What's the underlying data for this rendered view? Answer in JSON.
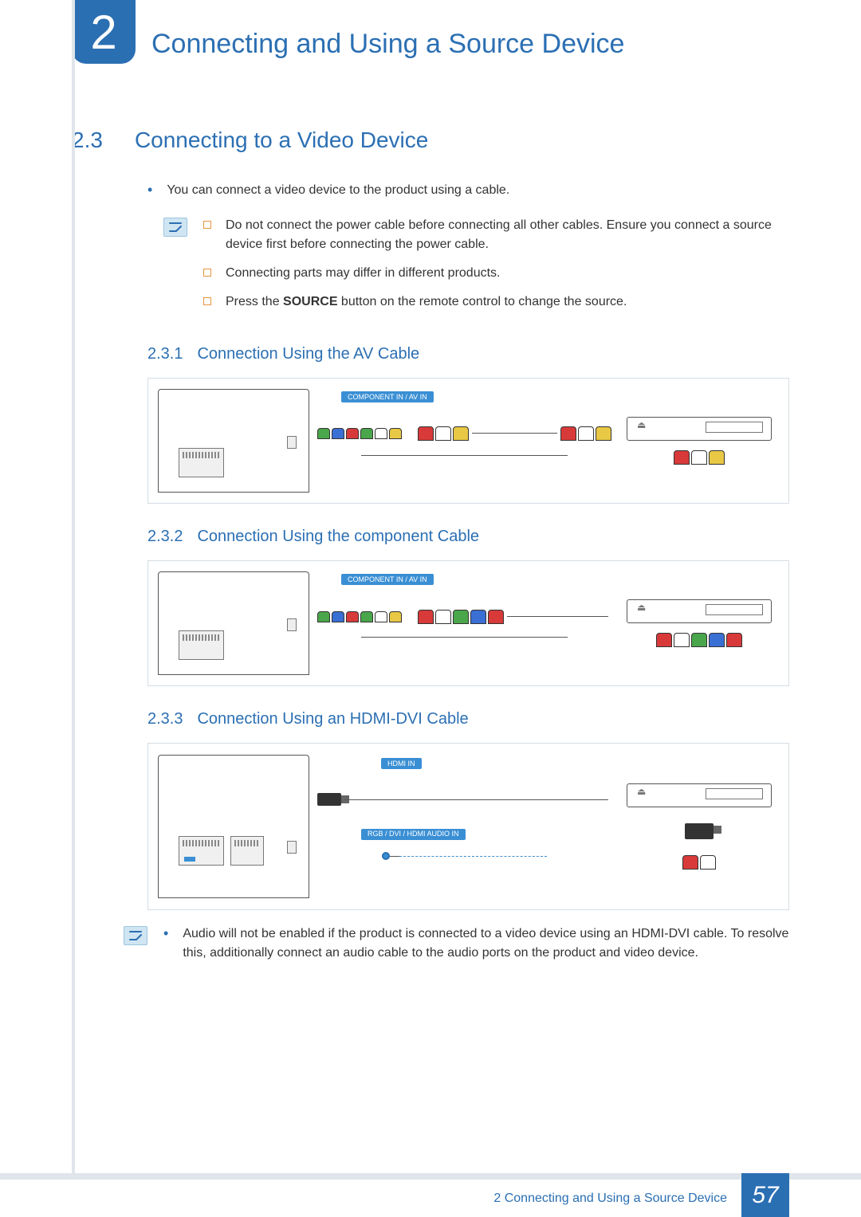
{
  "chapter": {
    "number": "2",
    "title": "Connecting and Using a Source Device"
  },
  "section": {
    "number": "2.3",
    "title": "Connecting to a Video Device"
  },
  "intro_bullet": "You can connect a video device to the product using a cable.",
  "notes": {
    "item1": "Do not connect the power cable before connecting all other cables. Ensure you connect a source device first before connecting the power cable.",
    "item2": "Connecting parts may differ in different products.",
    "item3_pre": "Press the ",
    "item3_bold": "SOURCE",
    "item3_post": " button on the remote control to change the source."
  },
  "subsections": {
    "s1": {
      "num": "2.3.1",
      "title": "Connection Using the AV Cable"
    },
    "s2": {
      "num": "2.3.2",
      "title": "Connection Using the component Cable"
    },
    "s3": {
      "num": "2.3.3",
      "title": "Connection Using an HDMI-DVI Cable"
    }
  },
  "port_labels": {
    "component_av": "COMPONENT IN / AV IN",
    "hdmi_in": "HDMI IN",
    "audio_in": "RGB / DVI / HDMI AUDIO IN"
  },
  "hdmi_note": "Audio will not be enabled if the product is connected to a video device using an HDMI-DVI cable. To resolve this, additionally connect an audio cable to the audio ports on the product and video device.",
  "footer": {
    "chapter_label": "2 Connecting and Using a Source Device",
    "page": "57"
  }
}
